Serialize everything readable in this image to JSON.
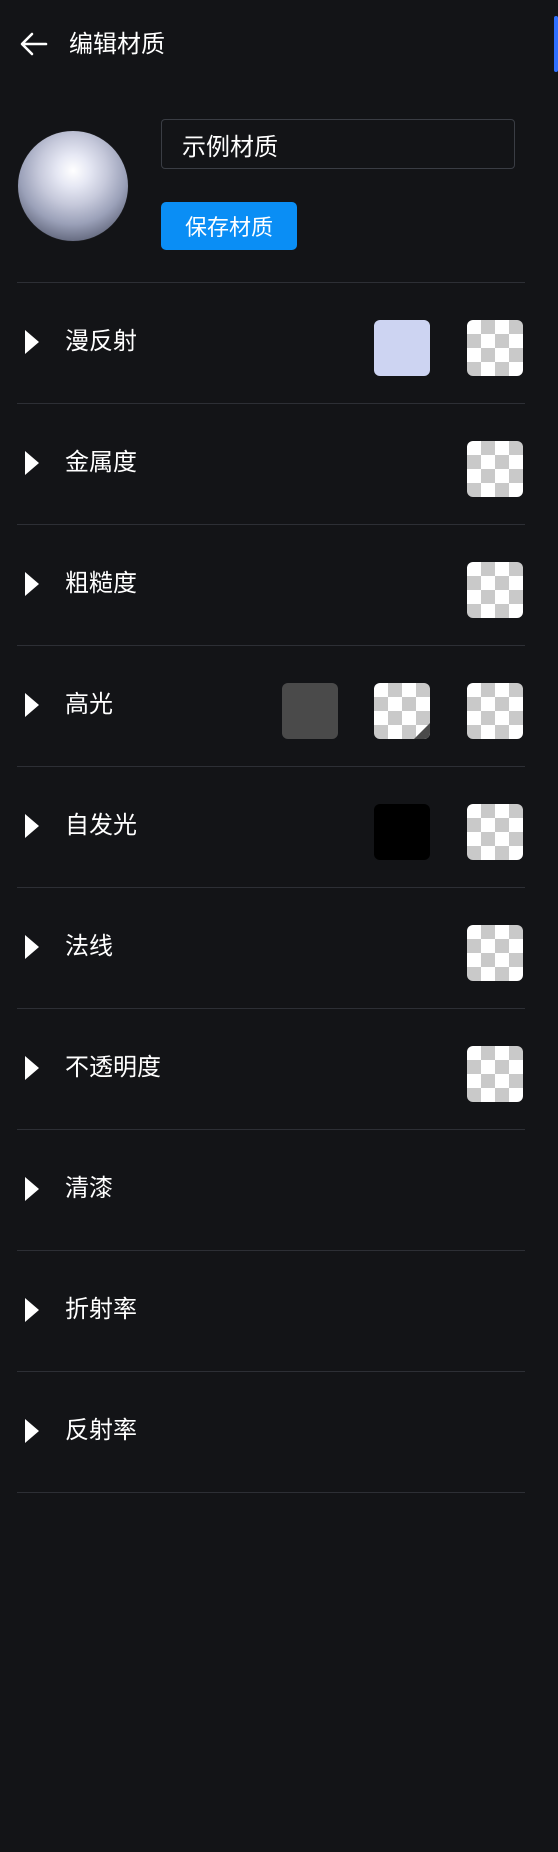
{
  "header": {
    "back_icon": "arrow-left-icon",
    "title": "编辑材质"
  },
  "material": {
    "name_value": "示例材质",
    "save_label": "保存材质",
    "preview_icon": "sphere-preview"
  },
  "colors": {
    "background": "#131417",
    "accent": "#0a8ef5",
    "divider": "#2d2f35",
    "diffuse_color": "#cdd4f2",
    "specular_color": "#4a4a4a",
    "emissive_color": "#000000"
  },
  "sections": [
    {
      "label": "漫反射",
      "color": "#cdd4f2",
      "texture": true
    },
    {
      "label": "金属度",
      "texture": true
    },
    {
      "label": "粗糙度",
      "texture": true
    },
    {
      "label": "高光",
      "color": "#4a4a4a",
      "texture_secondary": true,
      "texture": true
    },
    {
      "label": "自发光",
      "color": "#000000",
      "texture": true
    },
    {
      "label": "法线",
      "texture": true
    },
    {
      "label": "不透明度",
      "texture": true
    },
    {
      "label": "清漆"
    },
    {
      "label": "折射率"
    },
    {
      "label": "反射率"
    }
  ]
}
